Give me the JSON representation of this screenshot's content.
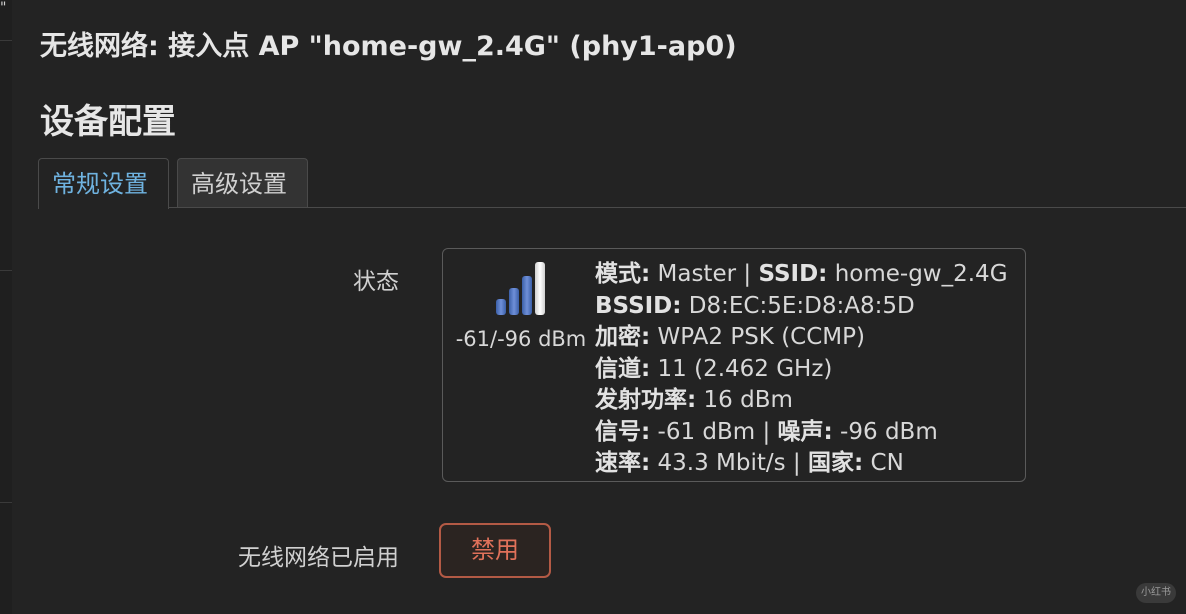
{
  "window": {
    "title": "无线网络: 接入点 AP \"home-gw_2.4G\" (phy1-ap0)",
    "corner_glyph": "\""
  },
  "section": {
    "title": "设备配置"
  },
  "tabs": [
    {
      "label": "常规设置",
      "active": true
    },
    {
      "label": "高级设置",
      "active": false
    }
  ],
  "status": {
    "label": "状态",
    "signal_text": "-61/-96 dBm",
    "signal_icon": "signal-strength-icon",
    "signal_bars_lit": 4,
    "signal_bars_total": 4,
    "rows": [
      [
        {
          "k": "模式:",
          "v": " Master | "
        },
        {
          "k": "SSID:",
          "v": " home-gw_2.4G"
        }
      ],
      [
        {
          "k": "BSSID:",
          "v": " D8:EC:5E:D8:A8:5D"
        }
      ],
      [
        {
          "k": "加密:",
          "v": " WPA2 PSK (CCMP)"
        }
      ],
      [
        {
          "k": "信道:",
          "v": " 11 (2.462 GHz)"
        }
      ],
      [
        {
          "k": "发射功率:",
          "v": " 16 dBm"
        }
      ],
      [
        {
          "k": "信号:",
          "v": " -61 dBm | "
        },
        {
          "k": "噪声:",
          "v": " -96 dBm"
        }
      ],
      [
        {
          "k": "速率:",
          "v": " 43.3 Mbit/s | "
        },
        {
          "k": "国家:",
          "v": " CN"
        }
      ]
    ]
  },
  "wireless_enabled": {
    "label": "无线网络已启用",
    "button_label": "禁用"
  },
  "watermark": {
    "text": "小红书"
  },
  "colors": {
    "accent_tab": "#6fb3e0",
    "button_danger": "#e0715a",
    "bar_blue": "#4a6fb8",
    "bar_light": "#e8e8e8"
  }
}
